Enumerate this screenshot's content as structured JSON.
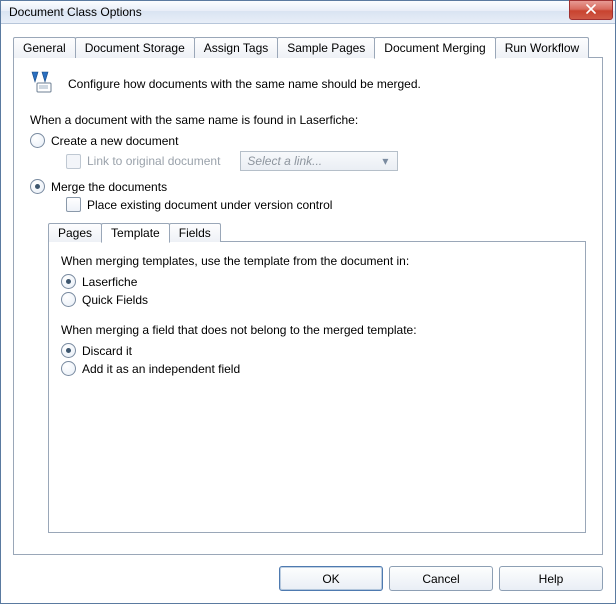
{
  "window": {
    "title": "Document Class Options"
  },
  "tabs": {
    "general": "General",
    "storage": "Document Storage",
    "assignTags": "Assign Tags",
    "samplePages": "Sample Pages",
    "merging": "Document Merging",
    "runWorkflow": "Run Workflow"
  },
  "merge": {
    "description": "Configure how documents with the same name should be merged.",
    "whenFound": "When a document with the same name is found in Laserfiche:",
    "createNew": "Create a new document",
    "linkOriginal": "Link to original document",
    "selectLinkPlaceholder": "Select a link...",
    "mergeDocs": "Merge the documents",
    "placeVersion": "Place existing document under version control"
  },
  "innerTabs": {
    "pages": "Pages",
    "template": "Template",
    "fields": "Fields"
  },
  "template": {
    "whenMergingTemplates": "When merging templates, use the template from the document in:",
    "laserfiche": "Laserfiche",
    "quickFields": "Quick Fields",
    "whenMergingField": "When merging a field that does not belong to the merged template:",
    "discard": "Discard it",
    "addIndependent": "Add it as an independent field"
  },
  "buttons": {
    "ok": "OK",
    "cancel": "Cancel",
    "help": "Help"
  }
}
